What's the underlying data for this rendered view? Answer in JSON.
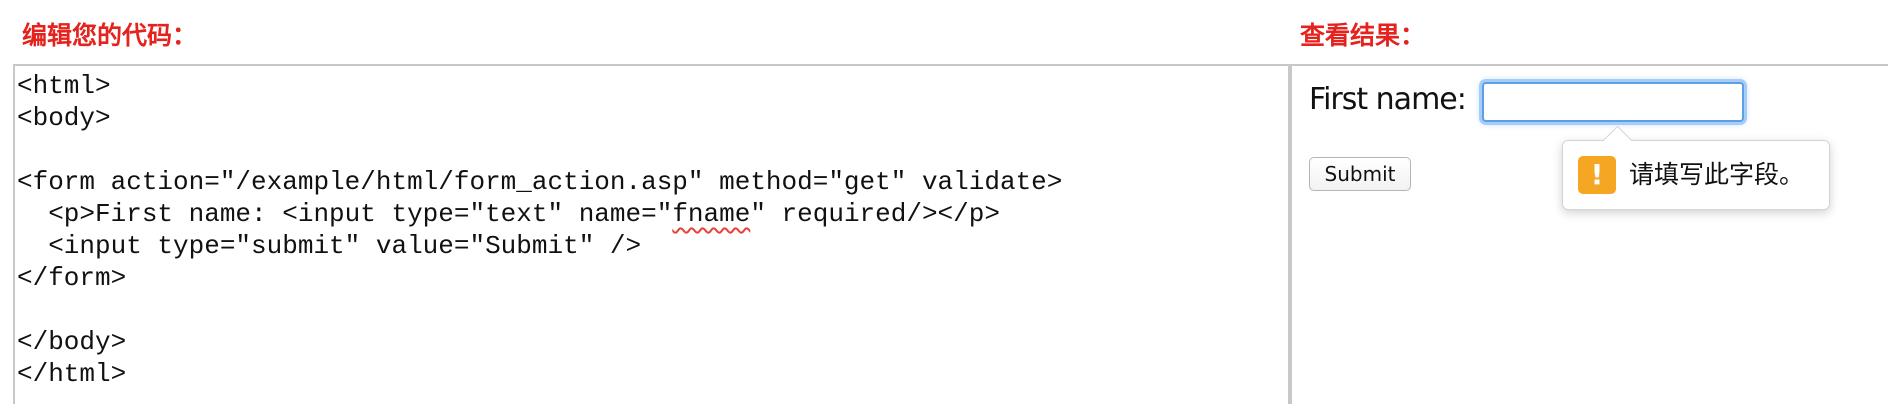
{
  "editor": {
    "heading": "编辑您的代码：",
    "lines": [
      "<html>",
      "<body>",
      "",
      "<form action=\"/example/html/form_action.asp\" method=\"get\" validate>",
      {
        "before": "  <p>First name: <input type=\"text\" name=\"",
        "misspelled": "fname",
        "after": "\" required/></p>"
      },
      "  <input type=\"submit\" value=\"Submit\" />",
      "</form>",
      "",
      "</body>",
      "</html>"
    ]
  },
  "result": {
    "heading": "查看结果：",
    "first_name_label": "First name:",
    "first_name_value": "",
    "submit_label": "Submit",
    "validation_message": "请填写此字段。",
    "validation_icon": "warning-icon",
    "colors": {
      "heading": "#e4231e",
      "focus_ring": "#5b9fe8",
      "warning": "#f5a623"
    }
  }
}
